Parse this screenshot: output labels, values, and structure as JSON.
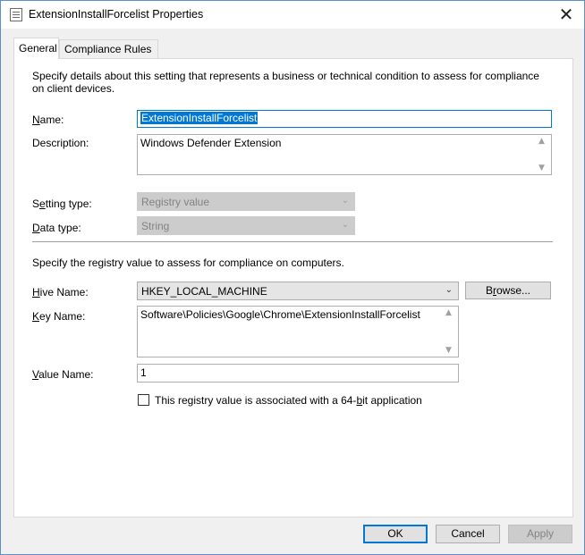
{
  "window": {
    "title": "ExtensionInstallForcelist Properties",
    "close_glyph": "✕"
  },
  "tabs": [
    {
      "label": "General",
      "active": true
    },
    {
      "label": "Compliance Rules",
      "active": false
    }
  ],
  "general": {
    "intro": "Specify details about this setting that represents a business or technical condition to assess for compliance on client devices.",
    "name_label_u": "N",
    "name_label_rest": "ame:",
    "name_value": "ExtensionInstallForcelist",
    "description_label": "Description:",
    "description_value": "Windows Defender Extension",
    "setting_type_label_pre": "S",
    "setting_type_label_u": "e",
    "setting_type_label_post": "tting type:",
    "setting_type_value": "Registry value",
    "data_type_label_u": "D",
    "data_type_label_rest": "ata type:",
    "data_type_value": "String"
  },
  "registry": {
    "intro": "Specify the registry value to assess for compliance on computers.",
    "hive_label_u": "H",
    "hive_label_rest": "ive Name:",
    "hive_value": "HKEY_LOCAL_MACHINE",
    "browse_pre": "B",
    "browse_u": "r",
    "browse_post": "owse...",
    "key_label_u": "K",
    "key_label_rest": "ey Name:",
    "key_value": "Software\\Policies\\Google\\Chrome\\ExtensionInstallForcelist",
    "value_label_u": "V",
    "value_label_rest": "alue Name:",
    "value_value": "1",
    "checkbox_label_pre": "This registry value is associated with a 64-",
    "checkbox_label_u": "b",
    "checkbox_label_post": "it application",
    "checkbox_checked": false
  },
  "footer": {
    "ok_label": "OK",
    "cancel_label": "Cancel",
    "apply_label": "Apply"
  },
  "colors": {
    "accent": "#0078d7",
    "window_border": "#5a8fc9",
    "disabled_fill": "#cccccc"
  },
  "icons": {
    "title": "properties-sheet-icon",
    "dropdown": "chevron-down-icon",
    "scroll_up": "scroll-up-arrow-icon",
    "scroll_down": "scroll-down-arrow-icon"
  }
}
